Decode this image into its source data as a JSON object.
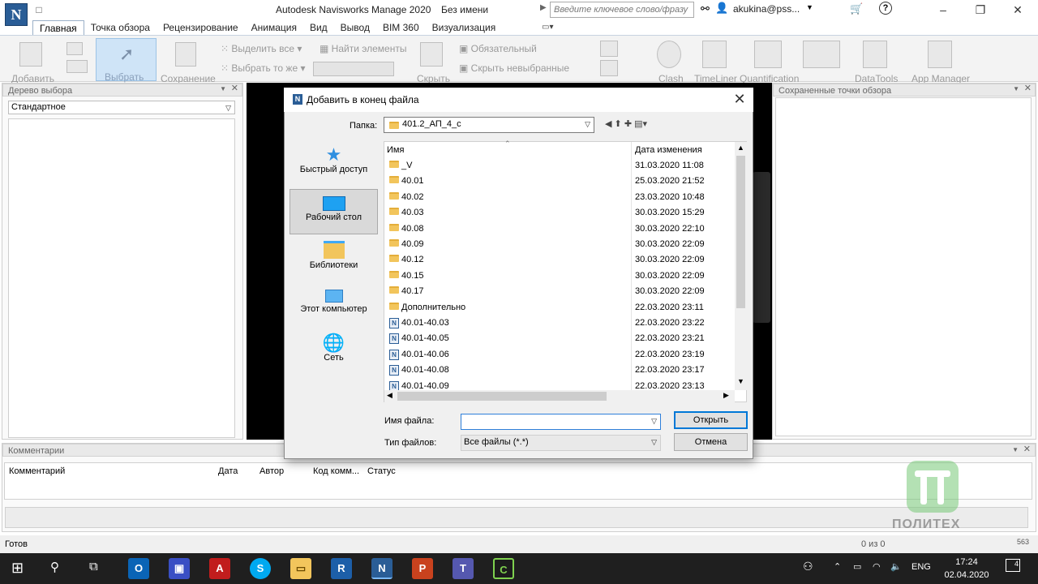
{
  "titlebar": {
    "app_title": "Autodesk Navisworks Manage 2020",
    "doc_name": "Без имени",
    "search_placeholder": "Введите ключевое слово/фразу",
    "user": "akukina@pss...",
    "logo_letter": "N"
  },
  "ribbon": {
    "tabs": [
      "Главная",
      "Точка обзора",
      "Рецензирование",
      "Анимация",
      "Вид",
      "Вывод",
      "BIM 360",
      "Визуализация"
    ],
    "items": {
      "add": "Добавить",
      "select": "Выбрать",
      "save": "Сохранение",
      "select_all": "Выделить все",
      "select_same": "Выбрать то же",
      "find_items": "Найти элементы",
      "required": "Обязательный",
      "hide_unselected": "Скрыть невыбранные",
      "hide": "Скрыть",
      "clash": "Clash",
      "timeliner": "TimeLiner",
      "quantification": "Quantification",
      "datatools": "DataTools",
      "app_manager": "App Manager"
    }
  },
  "left_panel": {
    "title": "Дерево выбора",
    "selector_value": "Стандартное"
  },
  "right_panel": {
    "title": "Сохраненные точки обзора"
  },
  "comments_panel": {
    "title": "Комментарии",
    "columns": [
      "Комментарий",
      "Дата",
      "Автор",
      "Код комм...",
      "Статус"
    ]
  },
  "statusbar": {
    "ready": "Готов",
    "pages": "0 из 0",
    "memory": "563"
  },
  "dialog": {
    "title": "Добавить в конец файла",
    "folder_label": "Папка:",
    "folder_value": "401.2_АП_4_с",
    "places": [
      "Быстрый доступ",
      "Рабочий стол",
      "Библиотеки",
      "Этот компьютер",
      "Сеть"
    ],
    "columns": {
      "name": "Имя",
      "date": "Дата изменения"
    },
    "files": [
      {
        "name": "_V",
        "date": "31.03.2020 11:08",
        "kind": "folder"
      },
      {
        "name": "40.01",
        "date": "25.03.2020 21:52",
        "kind": "folder"
      },
      {
        "name": "40.02",
        "date": "23.03.2020 10:48",
        "kind": "folder"
      },
      {
        "name": "40.03",
        "date": "30.03.2020 15:29",
        "kind": "folder"
      },
      {
        "name": "40.08",
        "date": "30.03.2020 22:10",
        "kind": "folder"
      },
      {
        "name": "40.09",
        "date": "30.03.2020 22:09",
        "kind": "folder"
      },
      {
        "name": "40.12",
        "date": "30.03.2020 22:09",
        "kind": "folder"
      },
      {
        "name": "40.15",
        "date": "30.03.2020 22:09",
        "kind": "folder"
      },
      {
        "name": "40.17",
        "date": "30.03.2020 22:09",
        "kind": "folder"
      },
      {
        "name": "Дополнительно",
        "date": "22.03.2020 23:11",
        "kind": "folder"
      },
      {
        "name": "40.01-40.03",
        "date": "22.03.2020 23:22",
        "kind": "nwd"
      },
      {
        "name": "40.01-40.05",
        "date": "22.03.2020 23:21",
        "kind": "nwd"
      },
      {
        "name": "40.01-40.06",
        "date": "22.03.2020 23:19",
        "kind": "nwd"
      },
      {
        "name": "40.01-40.08",
        "date": "22.03.2020 23:17",
        "kind": "nwd"
      },
      {
        "name": "40.01-40.09",
        "date": "22.03.2020 23:13",
        "kind": "nwd"
      }
    ],
    "filename_label": "Имя файла:",
    "filename_value": "",
    "filetype_label": "Тип файлов:",
    "filetype_value": "Все файлы (*.*)",
    "open_button": "Открыть",
    "cancel_button": "Отмена"
  },
  "taskbar": {
    "lang": "ENG",
    "time": "17:24",
    "date": "02.04.2020",
    "notifications": "4"
  },
  "watermark": {
    "text": "ПОЛИТЕХ"
  },
  "colors": {
    "accent": "#0078d7",
    "folder": "#f2c55c",
    "navis_blue": "#2a5d96",
    "taskbar": "#1f1f1f"
  }
}
